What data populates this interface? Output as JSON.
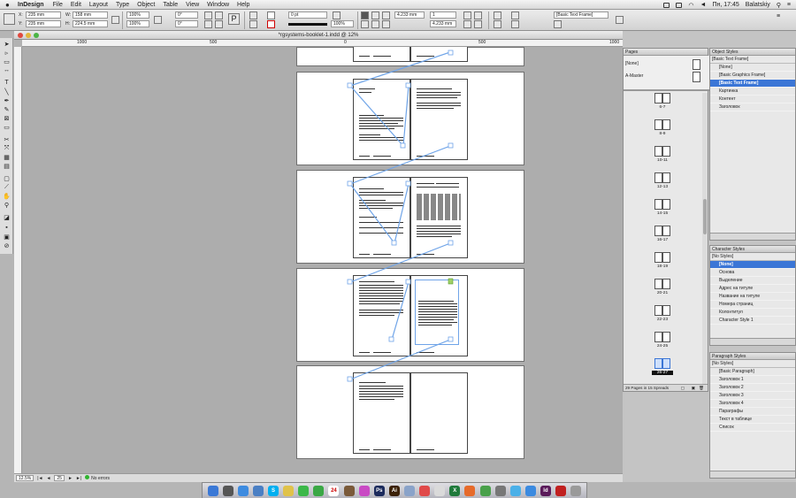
{
  "menubar": {
    "app_name": "InDesign",
    "items": [
      "File",
      "Edit",
      "Layout",
      "Type",
      "Object",
      "Table",
      "View",
      "Window",
      "Help"
    ],
    "clock": "Пн, 17:45",
    "user": "Balatskiy"
  },
  "control": {
    "x_label": "X:",
    "x_value": "235 mm",
    "y_label": "Y:",
    "y_value": "235 mm",
    "w_label": "W:",
    "w_value": "158 mm",
    "h_label": "H:",
    "h_value": "224.5 mm",
    "scale_x": "100%",
    "scale_y": "100%",
    "angle": "0°",
    "shear": "0°",
    "stroke_weight": "0 pt",
    "opacity": "100%",
    "offset": "4.233 mm",
    "columns": "1",
    "gutter": "4.233 mm",
    "style_select": "[Basic Text Frame]"
  },
  "document": {
    "title": "*rgsystems-booklet-1.indd @ 12%",
    "ruler": [
      "1000",
      "500",
      "0",
      "500",
      "1000"
    ],
    "zoom": "12.5%",
    "page_field": "25",
    "errors": "No errors"
  },
  "pages_panel": {
    "tab": "Pages",
    "none_label": "[None]",
    "master_label": "A-Master",
    "spreads": [
      "6-7",
      "8-9",
      "10-11",
      "12-13",
      "14-15",
      "16-17",
      "18-19",
      "20-21",
      "22-23",
      "24-25",
      "26-27"
    ],
    "footer": "29 Pages in 15 Spreads"
  },
  "object_styles": {
    "tab": "Object Styles",
    "current": "[Basic Text Frame]",
    "items": [
      "[None]",
      "[Basic Graphics Frame]",
      "[Basic Text Frame]",
      "Картинка",
      "Контент",
      "Заголовок"
    ],
    "selected": 2
  },
  "character_styles": {
    "tab": "Character Styles",
    "current": "[No Styles]",
    "items": [
      "[None]",
      "Основа",
      "Выделение",
      "Адрес на титуле",
      "Название на титуле",
      "Номера страниц",
      "Колонтитул",
      "Character Style 1"
    ],
    "selected": 0
  },
  "paragraph_styles": {
    "tab": "Paragraph Styles",
    "current": "[No Styles]",
    "items": [
      "[Basic Paragraph]",
      "Заголовок 1",
      "Заголовок 2",
      "Заголовок 3",
      "Заголовок 4",
      "Параграфы",
      "Текст в таблице",
      "Список"
    ]
  },
  "dock": {
    "icons": [
      "finder-icon",
      "launchpad-icon",
      "safari-icon",
      "mail-icon",
      "skype-icon",
      "notes-icon",
      "messages-icon",
      "facetime-icon",
      "calendar-icon",
      "photo-icon",
      "itunes-icon",
      "photoshop-icon",
      "illustrator-icon",
      "preview-icon",
      "music-icon",
      "chrome-icon",
      "excel-icon",
      "firefox-icon",
      "maps-icon",
      "utility-icon",
      "twitter-icon",
      "appstore-icon",
      "indesign-icon",
      "acrobat-icon",
      "trash-icon"
    ],
    "labels": {
      "skype": "S",
      "photoshop": "Ps",
      "illustrator": "Ai",
      "excel": "X",
      "indesign": "Id",
      "calendar": "24"
    },
    "colors": [
      "#3a78d6",
      "#555555",
      "#3d8be0",
      "#4a7fc4",
      "#00aff0",
      "#e0c24a",
      "#3cb84a",
      "#3aa845",
      "#ffffff",
      "#7a5a3a",
      "#c94ac4",
      "#1b2a5c",
      "#3b2106",
      "#8aa3c9",
      "#e04a4a",
      "#dadada",
      "#1f7a3b",
      "#e66a2a",
      "#49a04a",
      "#777777",
      "#4ab0e8",
      "#3b8ae0",
      "#5a1a5a",
      "#c02020",
      "#9a9a9a"
    ]
  },
  "colors": {
    "selection": "#3b76d6",
    "frame_link": "#6fa4e8"
  }
}
